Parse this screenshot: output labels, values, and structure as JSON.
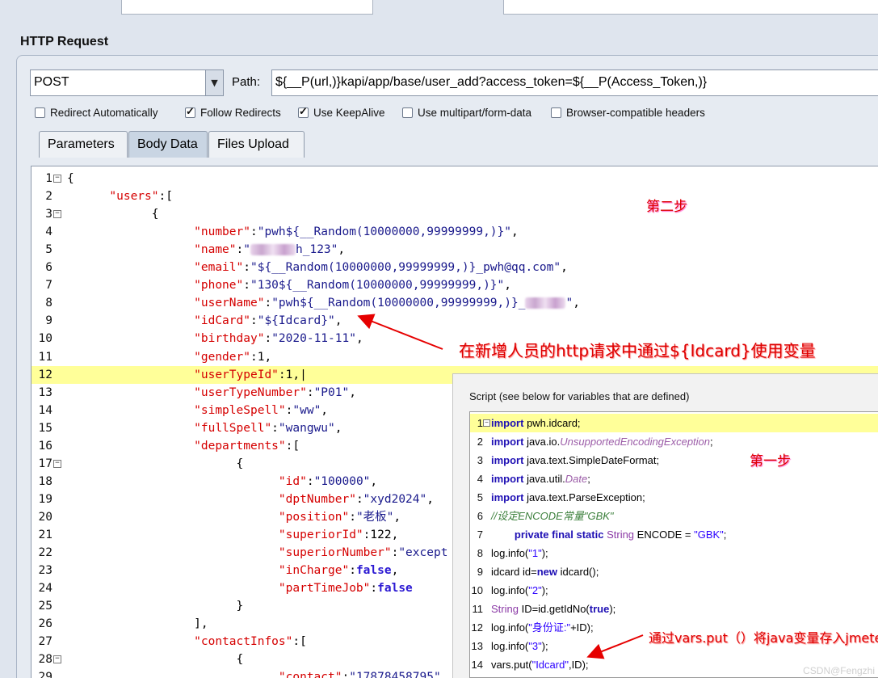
{
  "section_title": "HTTP Request",
  "method": "POST",
  "path_label": "Path:",
  "path_value": "${__P(url,)}kapi/app/base/user_add?access_token=${__P(Access_Token,)}",
  "options": [
    {
      "label": "Redirect Automatically",
      "checked": false
    },
    {
      "label": "Follow Redirects",
      "checked": true
    },
    {
      "label": "Use KeepAlive",
      "checked": true
    },
    {
      "label": "Use multipart/form-data",
      "checked": false
    },
    {
      "label": "Browser-compatible headers",
      "checked": false
    }
  ],
  "tabs": [
    "Parameters",
    "Body Data",
    "Files Upload"
  ],
  "active_tab": "Body Data",
  "body_lines": [
    {
      "n": "1",
      "fold": true,
      "parts": [
        [
          "n",
          "{"
        ]
      ]
    },
    {
      "n": "2",
      "parts": [
        [
          "n",
          "      "
        ],
        [
          "k",
          "\"users\""
        ],
        [
          "n",
          ":["
        ]
      ]
    },
    {
      "n": "3",
      "fold": true,
      "parts": [
        [
          "n",
          "            {"
        ]
      ]
    },
    {
      "n": "4",
      "parts": [
        [
          "n",
          "                  "
        ],
        [
          "k",
          "\"number\""
        ],
        [
          "n",
          ":"
        ],
        [
          "s",
          "\"pwh${__Random(10000000,99999999,)}\""
        ],
        [
          "n",
          ","
        ]
      ]
    },
    {
      "n": "5",
      "parts": [
        [
          "n",
          "                  "
        ],
        [
          "k",
          "\"name\""
        ],
        [
          "n",
          ":"
        ],
        [
          "s",
          "\""
        ],
        [
          "blur",
          "56"
        ],
        [
          "s",
          "h_123\""
        ],
        [
          "n",
          ","
        ]
      ]
    },
    {
      "n": "6",
      "parts": [
        [
          "n",
          "                  "
        ],
        [
          "k",
          "\"email\""
        ],
        [
          "n",
          ":"
        ],
        [
          "s",
          "\"${__Random(10000000,99999999,)}_pwh@qq.com\""
        ],
        [
          "n",
          ","
        ]
      ]
    },
    {
      "n": "7",
      "parts": [
        [
          "n",
          "                  "
        ],
        [
          "k",
          "\"phone\""
        ],
        [
          "n",
          ":"
        ],
        [
          "s",
          "\"130${__Random(10000000,99999999,)}\""
        ],
        [
          "n",
          ","
        ]
      ]
    },
    {
      "n": "8",
      "parts": [
        [
          "n",
          "                  "
        ],
        [
          "k",
          "\"userName\""
        ],
        [
          "n",
          ":"
        ],
        [
          "s",
          "\"pwh${__Random(10000000,99999999,)}_"
        ],
        [
          "blur",
          "50"
        ],
        [
          "s",
          "\""
        ],
        [
          "n",
          ","
        ]
      ]
    },
    {
      "n": "9",
      "parts": [
        [
          "n",
          "                  "
        ],
        [
          "k",
          "\"idCard\""
        ],
        [
          "n",
          ":"
        ],
        [
          "s",
          "\"${Idcard}\""
        ],
        [
          "n",
          ","
        ]
      ]
    },
    {
      "n": "10",
      "parts": [
        [
          "n",
          "                  "
        ],
        [
          "k",
          "\"birthday\""
        ],
        [
          "n",
          ":"
        ],
        [
          "s",
          "\"2020-11-11\""
        ],
        [
          "n",
          ","
        ]
      ]
    },
    {
      "n": "11",
      "parts": [
        [
          "n",
          "                  "
        ],
        [
          "k",
          "\"gender\""
        ],
        [
          "n",
          ":1,"
        ]
      ]
    },
    {
      "n": "12",
      "hl": true,
      "parts": [
        [
          "n",
          "                  "
        ],
        [
          "k",
          "\"userTypeId\""
        ],
        [
          "n",
          ":1,|"
        ]
      ]
    },
    {
      "n": "13",
      "parts": [
        [
          "n",
          "                  "
        ],
        [
          "k",
          "\"userTypeNumber\""
        ],
        [
          "n",
          ":"
        ],
        [
          "s",
          "\"P01\""
        ],
        [
          "n",
          ","
        ]
      ]
    },
    {
      "n": "14",
      "parts": [
        [
          "n",
          "                  "
        ],
        [
          "k",
          "\"simpleSpell\""
        ],
        [
          "n",
          ":"
        ],
        [
          "s",
          "\"ww\""
        ],
        [
          "n",
          ","
        ]
      ]
    },
    {
      "n": "15",
      "parts": [
        [
          "n",
          "                  "
        ],
        [
          "k",
          "\"fullSpell\""
        ],
        [
          "n",
          ":"
        ],
        [
          "s",
          "\"wangwu\""
        ],
        [
          "n",
          ","
        ]
      ]
    },
    {
      "n": "16",
      "parts": [
        [
          "n",
          "                  "
        ],
        [
          "k",
          "\"departments\""
        ],
        [
          "n",
          ":["
        ]
      ]
    },
    {
      "n": "17",
      "fold": true,
      "parts": [
        [
          "n",
          "                        {"
        ]
      ]
    },
    {
      "n": "18",
      "parts": [
        [
          "n",
          "                              "
        ],
        [
          "k",
          "\"id\""
        ],
        [
          "n",
          ":"
        ],
        [
          "s",
          "\"100000\""
        ],
        [
          "n",
          ","
        ]
      ]
    },
    {
      "n": "19",
      "parts": [
        [
          "n",
          "                              "
        ],
        [
          "k",
          "\"dptNumber\""
        ],
        [
          "n",
          ":"
        ],
        [
          "s",
          "\"xyd2024\""
        ],
        [
          "n",
          ","
        ]
      ]
    },
    {
      "n": "20",
      "parts": [
        [
          "n",
          "                              "
        ],
        [
          "k",
          "\"position\""
        ],
        [
          "n",
          ":"
        ],
        [
          "s",
          "\"老板\""
        ],
        [
          "n",
          ","
        ]
      ]
    },
    {
      "n": "21",
      "parts": [
        [
          "n",
          "                              "
        ],
        [
          "k",
          "\"superiorId\""
        ],
        [
          "n",
          ":122,"
        ]
      ]
    },
    {
      "n": "22",
      "parts": [
        [
          "n",
          "                              "
        ],
        [
          "k",
          "\"superiorNumber\""
        ],
        [
          "n",
          ":"
        ],
        [
          "s",
          "\"except"
        ]
      ]
    },
    {
      "n": "23",
      "parts": [
        [
          "n",
          "                              "
        ],
        [
          "k",
          "\"inCharge\""
        ],
        [
          "n",
          ":"
        ],
        [
          "kw",
          "false"
        ],
        [
          "n",
          ","
        ]
      ]
    },
    {
      "n": "24",
      "parts": [
        [
          "n",
          "                              "
        ],
        [
          "k",
          "\"partTimeJob\""
        ],
        [
          "n",
          ":"
        ],
        [
          "kw",
          "false"
        ]
      ]
    },
    {
      "n": "25",
      "parts": [
        [
          "n",
          "                        }"
        ]
      ]
    },
    {
      "n": "26",
      "parts": [
        [
          "n",
          "                  ],"
        ]
      ]
    },
    {
      "n": "27",
      "parts": [
        [
          "n",
          "                  "
        ],
        [
          "k",
          "\"contactInfos\""
        ],
        [
          "n",
          ":["
        ]
      ]
    },
    {
      "n": "28",
      "fold": true,
      "parts": [
        [
          "n",
          "                        {"
        ]
      ]
    },
    {
      "n": "29",
      "parts": [
        [
          "n",
          "                              "
        ],
        [
          "k",
          "\"contact\""
        ],
        [
          "n",
          ":"
        ],
        [
          "s",
          "\"17878458795\""
        ]
      ]
    }
  ],
  "annotation_step2": "第二步",
  "annotation_use_var": "在新增人员的http请求中通过${Idcard}使用变量",
  "script_title": "Script (see below for variables that are defined)",
  "script_lines": [
    {
      "n": "1",
      "fold": true,
      "hl": true,
      "parts": [
        [
          "j-kw",
          "import"
        ],
        [
          "n",
          " pwh.idcard;"
        ]
      ]
    },
    {
      "n": "2",
      "parts": [
        [
          "j-kw",
          "import"
        ],
        [
          "n",
          " java.io."
        ],
        [
          "j-cls",
          "UnsupportedEncodingException"
        ],
        [
          "n",
          ";"
        ]
      ]
    },
    {
      "n": "3",
      "parts": [
        [
          "j-kw",
          "import"
        ],
        [
          "n",
          " java.text.SimpleDateFormat;"
        ]
      ]
    },
    {
      "n": "4",
      "parts": [
        [
          "j-kw",
          "import"
        ],
        [
          "n",
          " java.util."
        ],
        [
          "j-cls",
          "Date"
        ],
        [
          "n",
          ";"
        ]
      ]
    },
    {
      "n": "5",
      "parts": [
        [
          "j-kw",
          "import"
        ],
        [
          "n",
          " java.text.ParseException;"
        ]
      ]
    },
    {
      "n": "6",
      "parts": [
        [
          "j-cmt",
          "//设定ENCODE常量\"GBK\""
        ]
      ]
    },
    {
      "n": "7",
      "parts": [
        [
          "n",
          "        "
        ],
        [
          "j-kw",
          "private final static"
        ],
        [
          "n",
          " "
        ],
        [
          "j-type",
          "String"
        ],
        [
          "n",
          " ENCODE = "
        ],
        [
          "j-str",
          "\"GBK\""
        ],
        [
          "n",
          ";"
        ]
      ]
    },
    {
      "n": "8",
      "parts": [
        [
          "n",
          "log.info("
        ],
        [
          "j-str",
          "\"1\""
        ],
        [
          "n",
          ");"
        ]
      ]
    },
    {
      "n": "9",
      "parts": [
        [
          "n",
          "idcard id="
        ],
        [
          "j-kw",
          "new"
        ],
        [
          "n",
          " idcard();"
        ]
      ]
    },
    {
      "n": "10",
      "parts": [
        [
          "n",
          "log.info("
        ],
        [
          "j-str",
          "\"2\""
        ],
        [
          "n",
          ");"
        ]
      ]
    },
    {
      "n": "11",
      "parts": [
        [
          "j-type",
          "String"
        ],
        [
          "n",
          " ID=id.getIdNo("
        ],
        [
          "j-kw",
          "true"
        ],
        [
          "n",
          ");"
        ]
      ]
    },
    {
      "n": "12",
      "parts": [
        [
          "n",
          "log.info("
        ],
        [
          "j-str",
          "\"身份证:\""
        ],
        [
          "n",
          "+ID);"
        ]
      ]
    },
    {
      "n": "13",
      "parts": [
        [
          "n",
          "log.info("
        ],
        [
          "j-str",
          "\"3\""
        ],
        [
          "n",
          ");"
        ]
      ]
    },
    {
      "n": "14",
      "parts": [
        [
          "n",
          "vars.put("
        ],
        [
          "j-str",
          "\"Idcard\""
        ],
        [
          "n",
          ",ID);"
        ]
      ]
    }
  ],
  "annotation_step1": "第一步",
  "annotation_vars": "通过vars.put（）将java变量存入jmeter变量",
  "watermark": "CSDN@Fengzhi"
}
